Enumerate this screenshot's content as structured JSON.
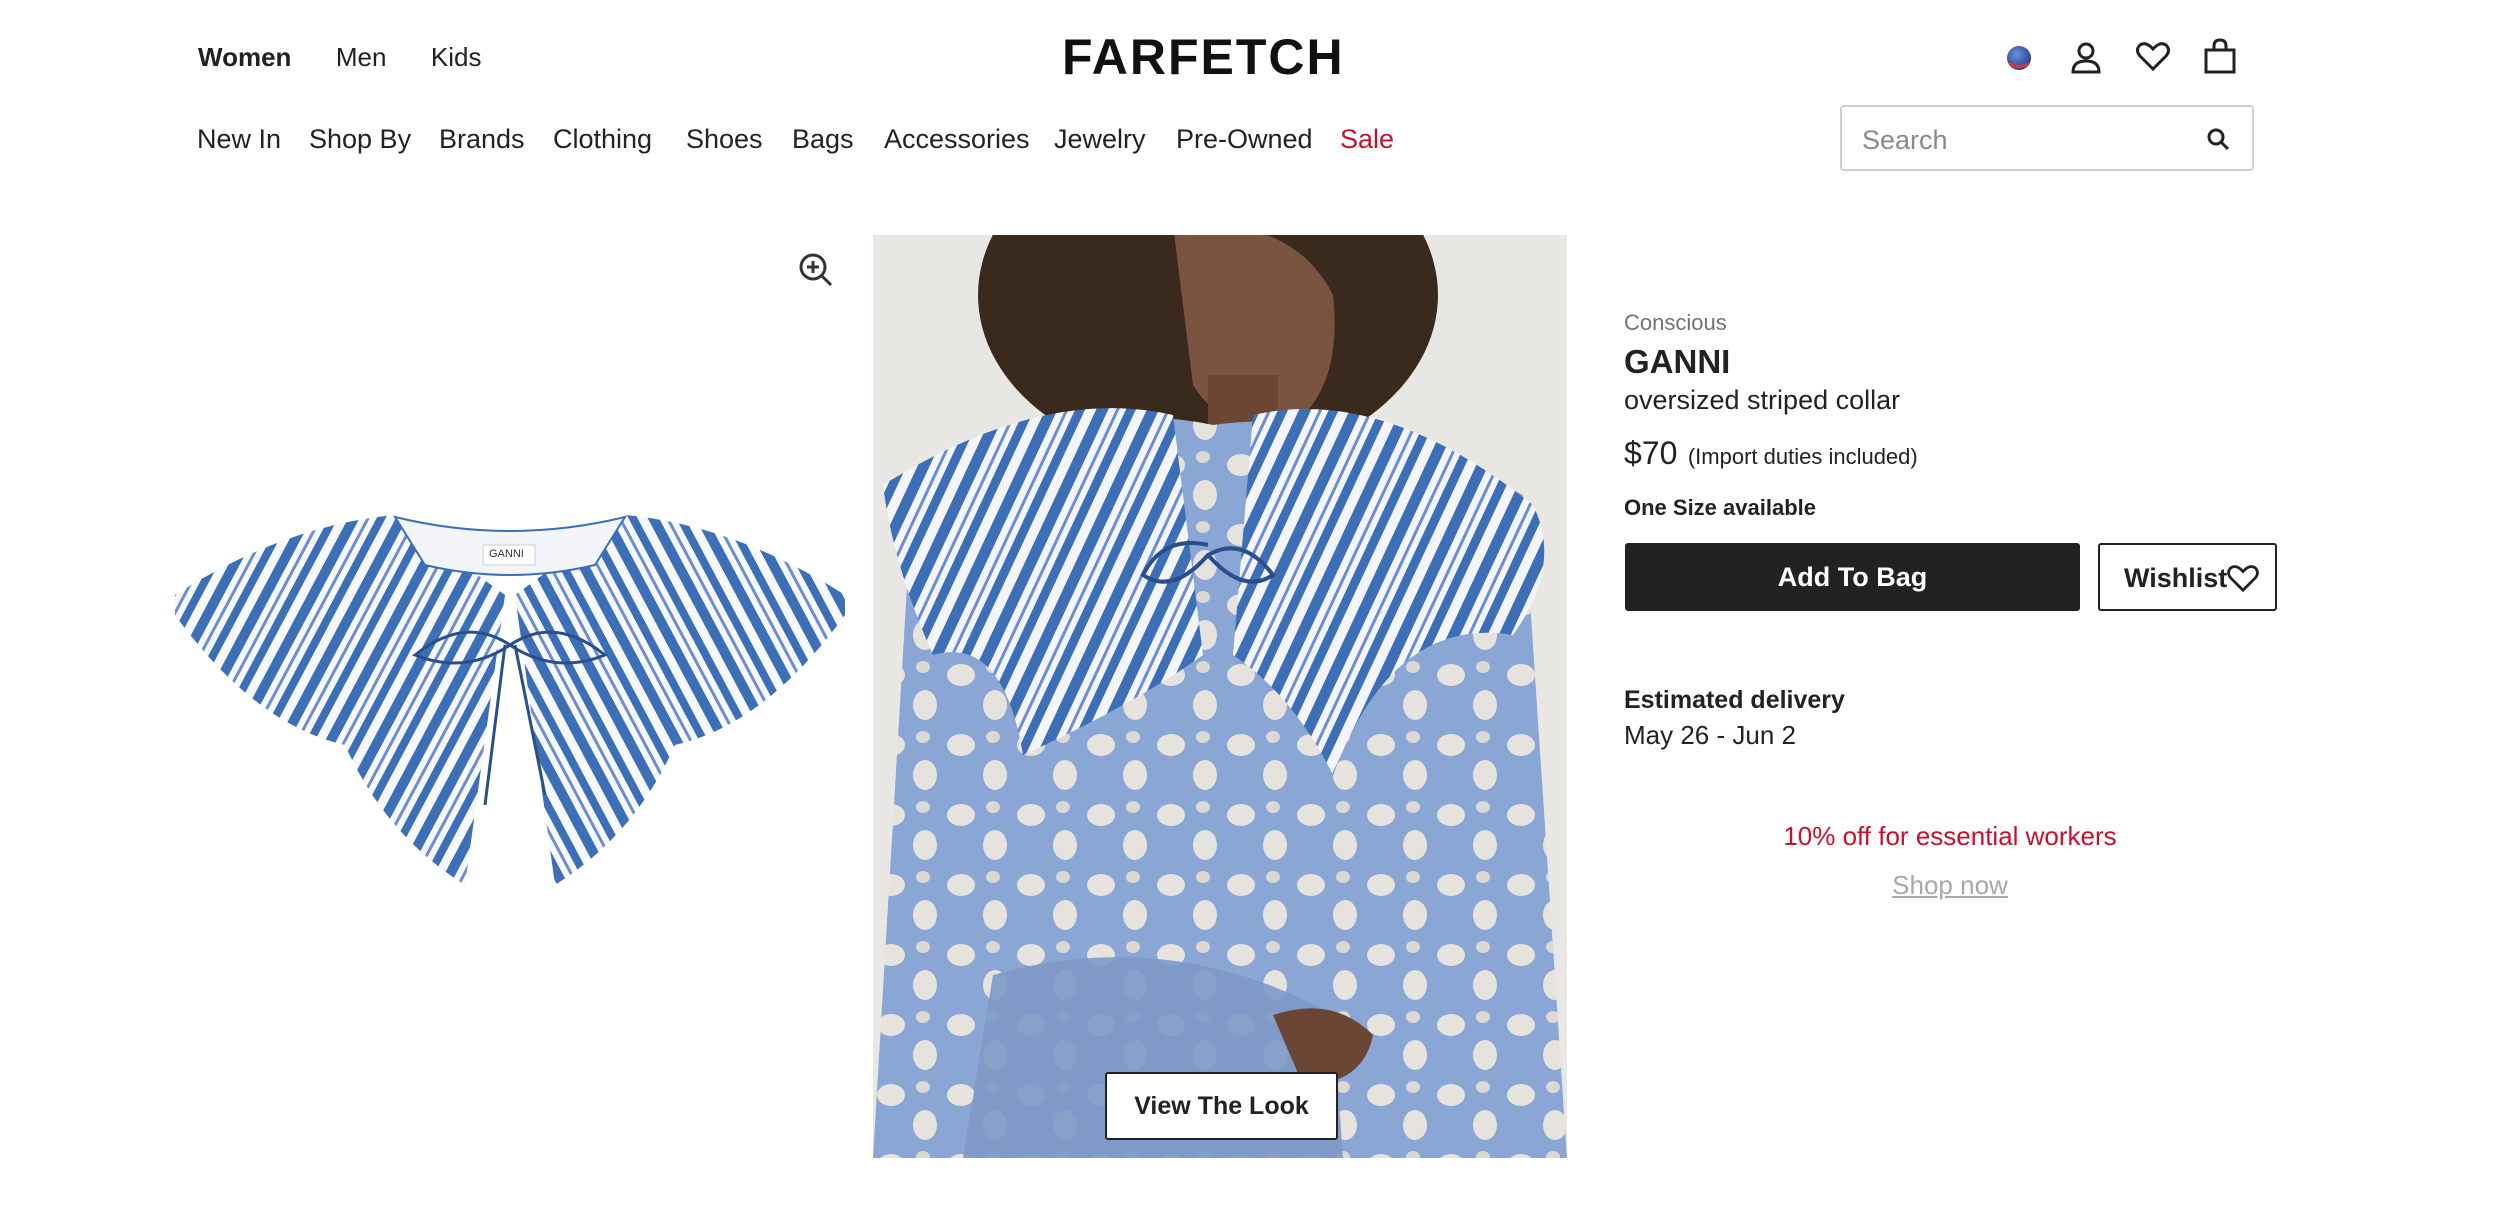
{
  "header": {
    "gender_tabs": [
      {
        "label": "Women",
        "active": true
      },
      {
        "label": "Men",
        "active": false
      },
      {
        "label": "Kids",
        "active": false
      }
    ],
    "logo": "FARFETCH",
    "icons": [
      "flag-icon",
      "account-icon",
      "wishlist-heart-icon",
      "shopping-bag-icon"
    ]
  },
  "nav": {
    "items": [
      "New In",
      "Shop By",
      "Brands",
      "Clothing",
      "Shoes",
      "Bags",
      "Accessories",
      "Jewelry",
      "Pre-Owned",
      "Sale"
    ],
    "sale_color": "#c8102e"
  },
  "search": {
    "placeholder": "Search"
  },
  "gallery": {
    "view_look_label": "View The Look",
    "collar_tag": "GANNI",
    "stripe_color": "#3d6fb6"
  },
  "product": {
    "tag": "Conscious",
    "brand": "GANNI",
    "name": "oversized striped collar",
    "price": "$70",
    "duties_note": "(Import duties included)",
    "size_note": "One Size available",
    "add_to_bag_label": "Add To Bag",
    "wishlist_label": "Wishlist",
    "delivery_title": "Estimated delivery",
    "delivery_dates": "May 26 - Jun 2",
    "promo_text": "10% off for essential workers",
    "promo_link": "Shop now",
    "promo_color": "#c8102e"
  }
}
